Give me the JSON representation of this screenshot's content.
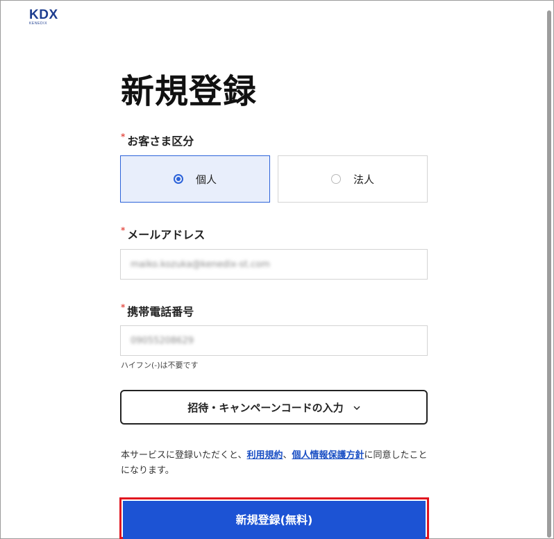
{
  "logo": {
    "main": "KDX",
    "sub": "KENEDIX"
  },
  "title": "新規登録",
  "customer_type": {
    "label": "お客さま区分",
    "required_mark": "*",
    "options": [
      {
        "label": "個人",
        "selected": true
      },
      {
        "label": "法人",
        "selected": false
      }
    ]
  },
  "email": {
    "label": "メールアドレス",
    "required_mark": "*",
    "value": "maiko.kozuka@kenedix-st.com"
  },
  "phone": {
    "label": "携帯電話番号",
    "required_mark": "*",
    "value": "09055208629",
    "hint": "ハイフン(-)は不要です"
  },
  "invite_code": {
    "label": "招待・キャンペーンコードの入力",
    "icon": "chevron-down-icon"
  },
  "terms": {
    "prefix": "本サービスに登録いただくと、",
    "link1": "利用規約",
    "separator": "、",
    "link2": "個人情報保護方針",
    "suffix": "に同意したことになります。"
  },
  "submit": {
    "label": "新規登録(無料)"
  },
  "colors": {
    "accent": "#2b62d9",
    "submit_bg": "#1c53d4",
    "highlight": "#e0141e",
    "required": "#e5534b"
  }
}
